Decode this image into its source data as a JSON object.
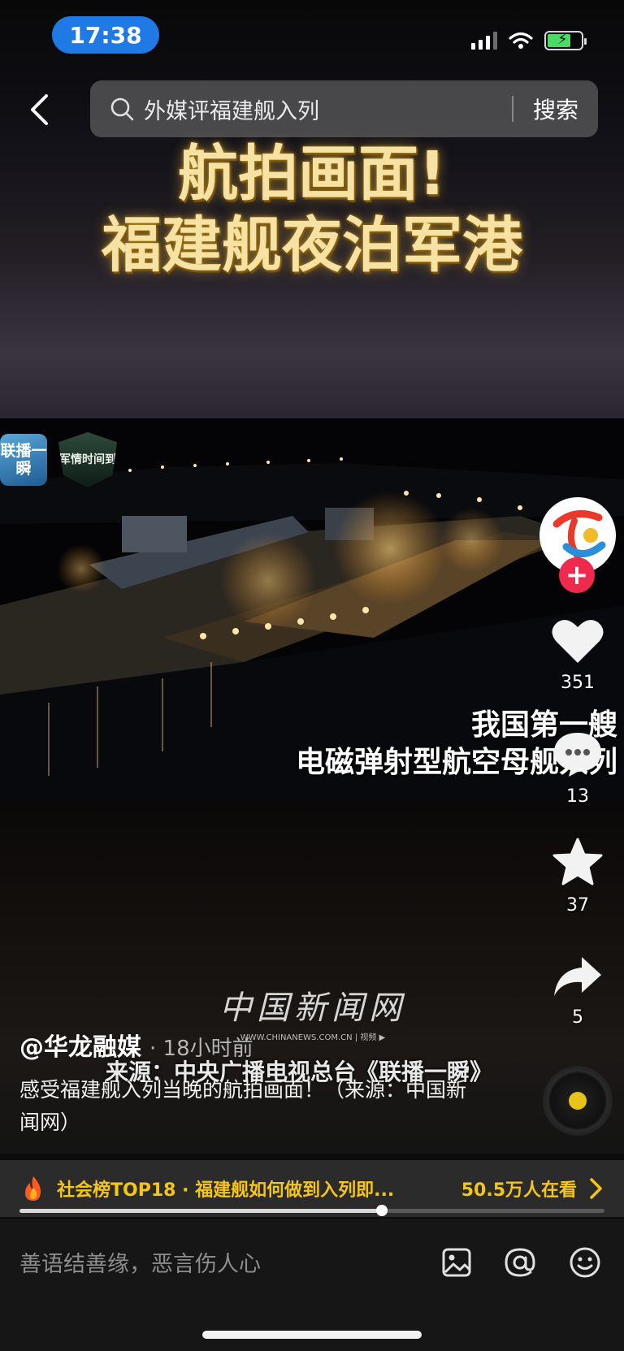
{
  "status_bar": {
    "time": "17:38"
  },
  "search": {
    "query": "外媒评福建舰入列",
    "button_label": "搜索"
  },
  "video": {
    "headline_line1": "航拍画面!",
    "headline_line2": "福建舰夜泊军港",
    "badge_lianbo": "联播一瞬",
    "badge_junqing": "军情时间到",
    "caption_line1": "我国第一艘",
    "caption_line2": "电磁弹射型航空母舰入列",
    "watermark_logo": "中国新闻网",
    "watermark_url": "WWW.CHINANEWS.COM.CN | 视频 ▶",
    "source_line": "来源：中央广播电视总台《联播一瞬》"
  },
  "actions": {
    "likes": "351",
    "comments": "13",
    "favorites": "37",
    "shares": "5"
  },
  "post": {
    "author": "@华龙融媒",
    "time_ago": "· 18小时前",
    "description": "感受福建舰入列当晚的航拍画面！（来源：中国新闻网）"
  },
  "hot_bar": {
    "label": "社会榜TOP18 · 福建舰如何做到入列即...",
    "viewers": "50.5万人在看"
  },
  "progress": {
    "played_fraction": 0.62
  },
  "comment_bar": {
    "placeholder": "善语结善缘，恶言伤人心"
  },
  "colors": {
    "accent_pink": "#f0294e",
    "hot_yellow": "#f5c518",
    "time_pill_blue": "#1f7ae6"
  },
  "icons": [
    "back-icon",
    "search-icon",
    "heart-icon",
    "comment-icon",
    "star-icon",
    "share-icon",
    "fire-icon",
    "chevron-right-icon",
    "image-icon",
    "at-icon",
    "emoji-icon"
  ]
}
